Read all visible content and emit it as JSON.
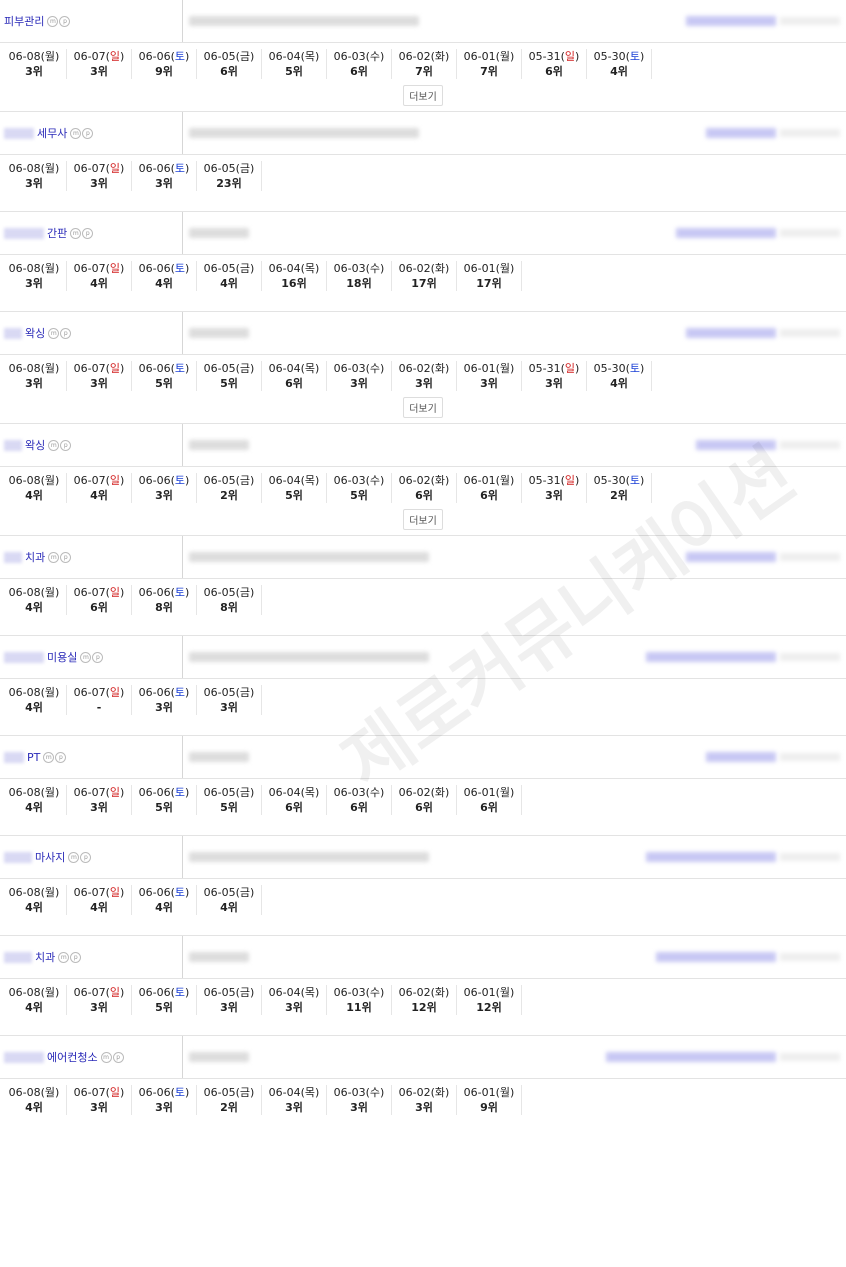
{
  "more_label": "더보기",
  "mp_icons": [
    "m",
    "p"
  ],
  "watermark": "제로커뮤니케이션",
  "entries": [
    {
      "keyword": "피부관리",
      "has_more": true,
      "days": [
        {
          "d": "06-08",
          "w": "월",
          "c": "n",
          "r": "3위"
        },
        {
          "d": "06-07",
          "w": "일",
          "c": "r",
          "r": "3위"
        },
        {
          "d": "06-06",
          "w": "토",
          "c": "b",
          "r": "9위"
        },
        {
          "d": "06-05",
          "w": "금",
          "c": "n",
          "r": "6위"
        },
        {
          "d": "06-04",
          "w": "목",
          "c": "n",
          "r": "5위"
        },
        {
          "d": "06-03",
          "w": "수",
          "c": "n",
          "r": "6위"
        },
        {
          "d": "06-02",
          "w": "화",
          "c": "n",
          "r": "7위"
        },
        {
          "d": "06-01",
          "w": "월",
          "c": "n",
          "r": "7위"
        },
        {
          "d": "05-31",
          "w": "일",
          "c": "r",
          "r": "6위"
        },
        {
          "d": "05-30",
          "w": "토",
          "c": "b",
          "r": "4위"
        }
      ]
    },
    {
      "keyword": "세무사",
      "has_more": false,
      "days": [
        {
          "d": "06-08",
          "w": "월",
          "c": "n",
          "r": "3위"
        },
        {
          "d": "06-07",
          "w": "일",
          "c": "r",
          "r": "3위"
        },
        {
          "d": "06-06",
          "w": "토",
          "c": "b",
          "r": "3위"
        },
        {
          "d": "06-05",
          "w": "금",
          "c": "n",
          "r": "23위"
        }
      ]
    },
    {
      "keyword": "간판",
      "has_more": false,
      "days": [
        {
          "d": "06-08",
          "w": "월",
          "c": "n",
          "r": "3위"
        },
        {
          "d": "06-07",
          "w": "일",
          "c": "r",
          "r": "4위"
        },
        {
          "d": "06-06",
          "w": "토",
          "c": "b",
          "r": "4위"
        },
        {
          "d": "06-05",
          "w": "금",
          "c": "n",
          "r": "4위"
        },
        {
          "d": "06-04",
          "w": "목",
          "c": "n",
          "r": "16위"
        },
        {
          "d": "06-03",
          "w": "수",
          "c": "n",
          "r": "18위"
        },
        {
          "d": "06-02",
          "w": "화",
          "c": "n",
          "r": "17위"
        },
        {
          "d": "06-01",
          "w": "월",
          "c": "n",
          "r": "17위"
        }
      ]
    },
    {
      "keyword": "왁싱",
      "has_more": true,
      "days": [
        {
          "d": "06-08",
          "w": "월",
          "c": "n",
          "r": "3위"
        },
        {
          "d": "06-07",
          "w": "일",
          "c": "r",
          "r": "3위"
        },
        {
          "d": "06-06",
          "w": "토",
          "c": "b",
          "r": "5위"
        },
        {
          "d": "06-05",
          "w": "금",
          "c": "n",
          "r": "5위"
        },
        {
          "d": "06-04",
          "w": "목",
          "c": "n",
          "r": "6위"
        },
        {
          "d": "06-03",
          "w": "수",
          "c": "n",
          "r": "3위"
        },
        {
          "d": "06-02",
          "w": "화",
          "c": "n",
          "r": "3위"
        },
        {
          "d": "06-01",
          "w": "월",
          "c": "n",
          "r": "3위"
        },
        {
          "d": "05-31",
          "w": "일",
          "c": "r",
          "r": "3위"
        },
        {
          "d": "05-30",
          "w": "토",
          "c": "b",
          "r": "4위"
        }
      ]
    },
    {
      "keyword": "왁싱",
      "has_more": true,
      "days": [
        {
          "d": "06-08",
          "w": "월",
          "c": "n",
          "r": "4위"
        },
        {
          "d": "06-07",
          "w": "일",
          "c": "r",
          "r": "4위"
        },
        {
          "d": "06-06",
          "w": "토",
          "c": "b",
          "r": "3위"
        },
        {
          "d": "06-05",
          "w": "금",
          "c": "n",
          "r": "2위"
        },
        {
          "d": "06-04",
          "w": "목",
          "c": "n",
          "r": "5위"
        },
        {
          "d": "06-03",
          "w": "수",
          "c": "n",
          "r": "5위"
        },
        {
          "d": "06-02",
          "w": "화",
          "c": "n",
          "r": "6위"
        },
        {
          "d": "06-01",
          "w": "월",
          "c": "n",
          "r": "6위"
        },
        {
          "d": "05-31",
          "w": "일",
          "c": "r",
          "r": "3위"
        },
        {
          "d": "05-30",
          "w": "토",
          "c": "b",
          "r": "2위"
        }
      ]
    },
    {
      "keyword": "치과",
      "has_more": false,
      "days": [
        {
          "d": "06-08",
          "w": "월",
          "c": "n",
          "r": "4위"
        },
        {
          "d": "06-07",
          "w": "일",
          "c": "r",
          "r": "6위"
        },
        {
          "d": "06-06",
          "w": "토",
          "c": "b",
          "r": "8위"
        },
        {
          "d": "06-05",
          "w": "금",
          "c": "n",
          "r": "8위"
        }
      ]
    },
    {
      "keyword": "미용실",
      "has_more": false,
      "days": [
        {
          "d": "06-08",
          "w": "월",
          "c": "n",
          "r": "4위"
        },
        {
          "d": "06-07",
          "w": "일",
          "c": "r",
          "r": "-"
        },
        {
          "d": "06-06",
          "w": "토",
          "c": "b",
          "r": "3위"
        },
        {
          "d": "06-05",
          "w": "금",
          "c": "n",
          "r": "3위"
        }
      ]
    },
    {
      "keyword": "PT",
      "has_more": false,
      "days": [
        {
          "d": "06-08",
          "w": "월",
          "c": "n",
          "r": "4위"
        },
        {
          "d": "06-07",
          "w": "일",
          "c": "r",
          "r": "3위"
        },
        {
          "d": "06-06",
          "w": "토",
          "c": "b",
          "r": "5위"
        },
        {
          "d": "06-05",
          "w": "금",
          "c": "n",
          "r": "5위"
        },
        {
          "d": "06-04",
          "w": "목",
          "c": "n",
          "r": "6위"
        },
        {
          "d": "06-03",
          "w": "수",
          "c": "n",
          "r": "6위"
        },
        {
          "d": "06-02",
          "w": "화",
          "c": "n",
          "r": "6위"
        },
        {
          "d": "06-01",
          "w": "월",
          "c": "n",
          "r": "6위"
        }
      ]
    },
    {
      "keyword": "마사지",
      "has_more": false,
      "days": [
        {
          "d": "06-08",
          "w": "월",
          "c": "n",
          "r": "4위"
        },
        {
          "d": "06-07",
          "w": "일",
          "c": "r",
          "r": "4위"
        },
        {
          "d": "06-06",
          "w": "토",
          "c": "b",
          "r": "4위"
        },
        {
          "d": "06-05",
          "w": "금",
          "c": "n",
          "r": "4위"
        }
      ]
    },
    {
      "keyword": "치과",
      "has_more": false,
      "days": [
        {
          "d": "06-08",
          "w": "월",
          "c": "n",
          "r": "4위"
        },
        {
          "d": "06-07",
          "w": "일",
          "c": "r",
          "r": "3위"
        },
        {
          "d": "06-06",
          "w": "토",
          "c": "b",
          "r": "5위"
        },
        {
          "d": "06-05",
          "w": "금",
          "c": "n",
          "r": "3위"
        },
        {
          "d": "06-04",
          "w": "목",
          "c": "n",
          "r": "3위"
        },
        {
          "d": "06-03",
          "w": "수",
          "c": "n",
          "r": "11위"
        },
        {
          "d": "06-02",
          "w": "화",
          "c": "n",
          "r": "12위"
        },
        {
          "d": "06-01",
          "w": "월",
          "c": "n",
          "r": "12위"
        }
      ]
    },
    {
      "keyword": "에어컨청소",
      "has_more": false,
      "days": [
        {
          "d": "06-08",
          "w": "월",
          "c": "n",
          "r": "4위"
        },
        {
          "d": "06-07",
          "w": "일",
          "c": "r",
          "r": "3위"
        },
        {
          "d": "06-06",
          "w": "토",
          "c": "b",
          "r": "3위"
        },
        {
          "d": "06-05",
          "w": "금",
          "c": "n",
          "r": "2위"
        },
        {
          "d": "06-04",
          "w": "목",
          "c": "n",
          "r": "3위"
        },
        {
          "d": "06-03",
          "w": "수",
          "c": "n",
          "r": "3위"
        },
        {
          "d": "06-02",
          "w": "화",
          "c": "n",
          "r": "3위"
        },
        {
          "d": "06-01",
          "w": "월",
          "c": "n",
          "r": "9위"
        }
      ]
    }
  ]
}
